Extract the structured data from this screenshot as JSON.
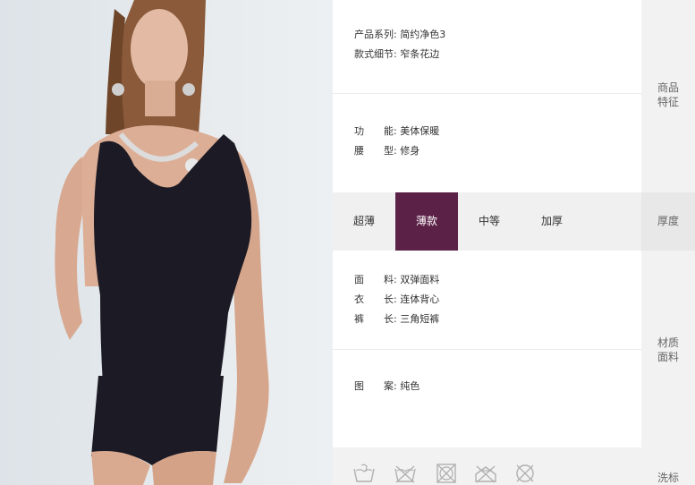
{
  "product_series": {
    "label": "产品系列:",
    "value": "简约净色3"
  },
  "style_detail": {
    "label": "款式细节:",
    "value": "窄条花边"
  },
  "function": {
    "label": "功　　能:",
    "value": "美体保暖"
  },
  "waist": {
    "label": "腰　　型:",
    "value": "修身"
  },
  "thickness": {
    "options": [
      "超薄",
      "薄款",
      "中等",
      "加厚"
    ],
    "selected": "薄款",
    "side_label": "厚度"
  },
  "fabric": {
    "label": "面　　料:",
    "value": "双弹面料"
  },
  "top_length": {
    "label": "衣　　长:",
    "value": "连体背心"
  },
  "pants_length": {
    "label": "裤　　长:",
    "value": "三角短裤"
  },
  "pattern": {
    "label": "图　　案:",
    "value": "纯色"
  },
  "side_labels": {
    "features": "商品\n特征",
    "material": "材质\n面料",
    "wash": "洗标"
  },
  "care_icons": [
    "hand-wash-icon",
    "no-machine-wash-icon",
    "no-tumble-dry-icon",
    "no-bleach-icon",
    "no-dry-clean-icon"
  ],
  "colors": {
    "accent": "#5b2146",
    "garment": "#1c1a24"
  }
}
